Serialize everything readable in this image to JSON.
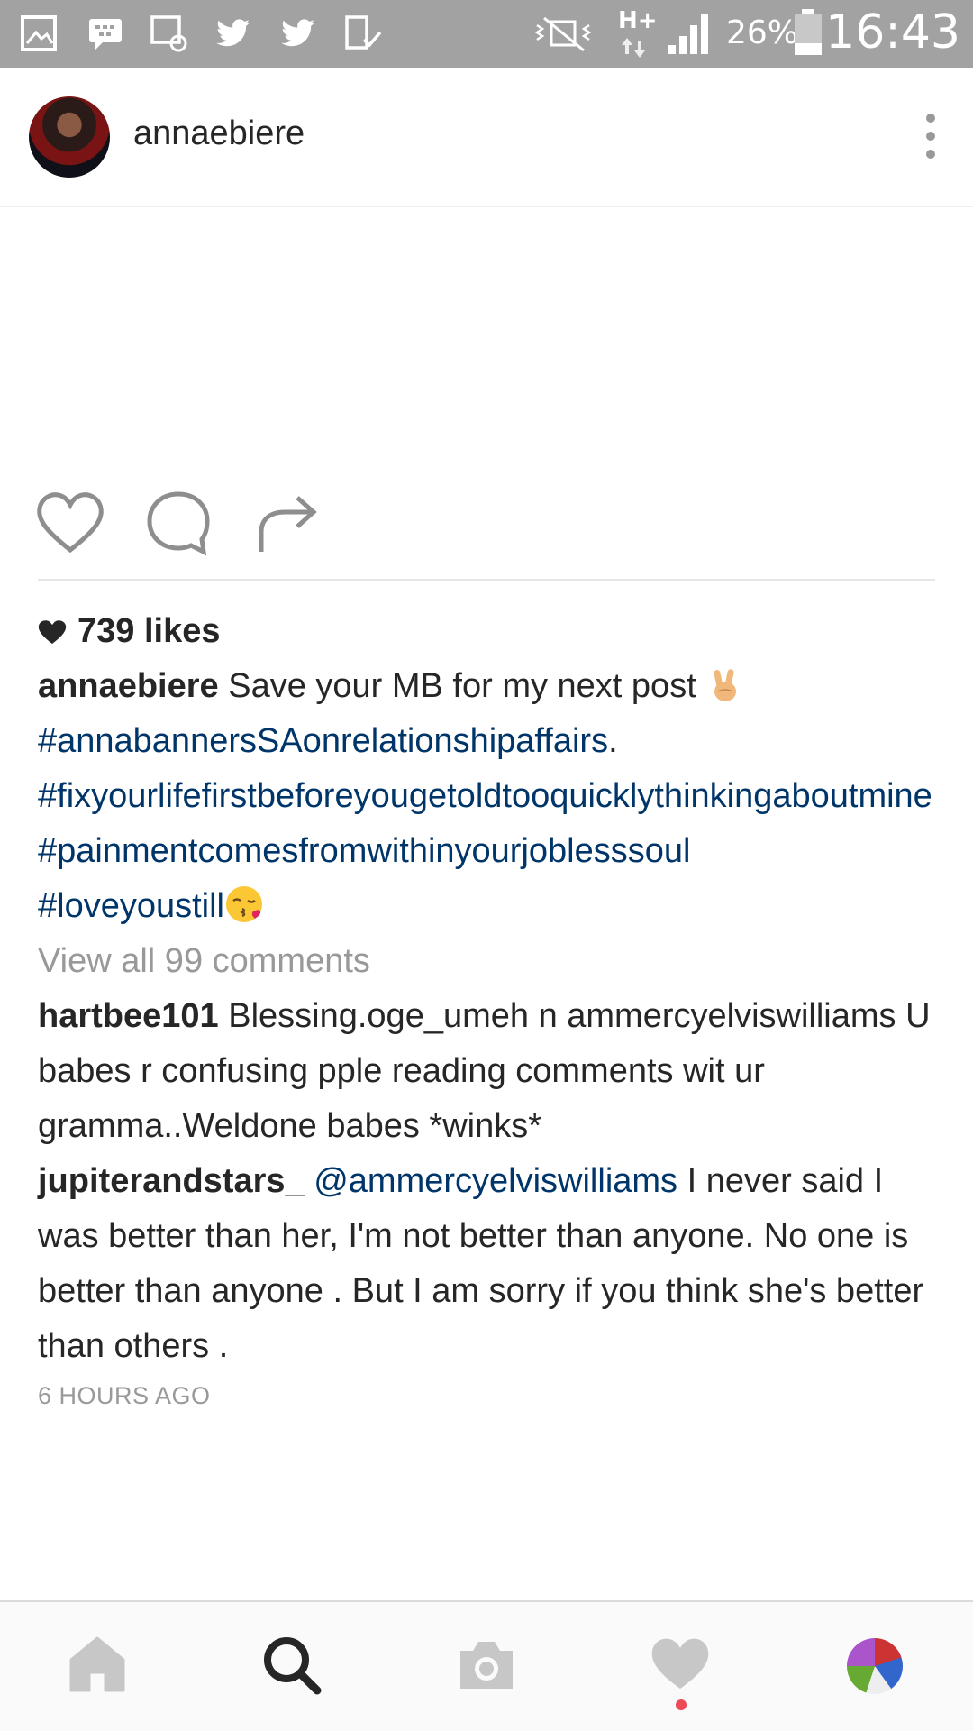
{
  "status_bar": {
    "network": "H+",
    "battery": "26%",
    "time": "16:43"
  },
  "post": {
    "username": "annaebiere",
    "likes": "739 likes",
    "caption": {
      "user": "annaebiere",
      "text": "Save your MB for my next post",
      "tag1": "#annabannersSAonrelationshipaffairs",
      "tag1_suffix": ".",
      "tag2": "#fixyourlifefirstbeforeyougetoldtooquicklythinkingaboutmine",
      "tag3": "#painmentcomesfromwithinyourjoblesssoul",
      "tag4": "#loveyoustill"
    },
    "view_all": "View all 99 comments",
    "comments": [
      {
        "user": "hartbee101",
        "text": "Blessing.oge_umeh n ammercyelviswilliams U babes r confusing pple reading comments wit ur gramma..Weldone babes *winks*"
      },
      {
        "user": "jupiterandstars_",
        "mention": "@ammercyelviswilliams",
        "text": "I never said I was better than her, I'm not better than anyone. No one is better than anyone . But I am sorry if you think she's better than others ."
      }
    ],
    "timestamp": "6 HOURS AGO"
  },
  "icons": {
    "header": [
      "avatar",
      "more-vertical-icon"
    ],
    "actions": [
      "like-heart-icon",
      "comment-bubble-icon",
      "share-arrow-icon"
    ],
    "bottom_nav": [
      "home-icon",
      "search-icon",
      "camera-icon",
      "activity-heart-icon",
      "profile-avatar"
    ]
  },
  "colors": {
    "status_bar": "#a2a2a2",
    "hashtag": "#003569",
    "muted": "#999999",
    "notification_dot": "#ed4956"
  }
}
